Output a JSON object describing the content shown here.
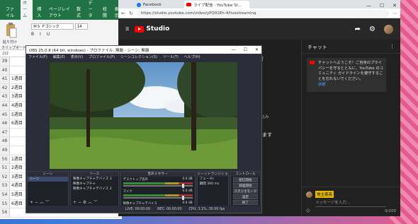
{
  "excel": {
    "tabs": [
      "ファイル",
      "ホーム",
      "挿入",
      "ページレイアウト",
      "数式",
      "データ",
      "校閲",
      "表示"
    ],
    "paste_label": "貼り付け",
    "font": "ＭＳ Ｐゴシック",
    "font_size": "14",
    "format": "B I U",
    "clipboard_label": "クリップボード",
    "cell_ref": "J12",
    "rows": [
      {
        "n": "39",
        "c": ""
      },
      {
        "n": "40",
        "c": ""
      },
      {
        "n": "41",
        "c": "1週目"
      },
      {
        "n": "42",
        "c": "2週目"
      },
      {
        "n": "43",
        "c": "3週目"
      },
      {
        "n": "44",
        "c": "4週目"
      },
      {
        "n": "45",
        "c": "5週目"
      },
      {
        "n": "46",
        "c": "6週目"
      },
      {
        "n": "47",
        "c": ""
      },
      {
        "n": "48",
        "c": ""
      },
      {
        "n": "49",
        "c": ""
      },
      {
        "n": "50",
        "c": "1週目"
      },
      {
        "n": "51",
        "c": "2週目"
      },
      {
        "n": "52",
        "c": "3週目"
      },
      {
        "n": "53",
        "c": "4週目"
      },
      {
        "n": "54",
        "c": "5週目"
      },
      {
        "n": "55",
        "c": "6週目"
      },
      {
        "n": "56",
        "c": ""
      }
    ]
  },
  "browser": {
    "tab1": "Facebook",
    "tab2": "ライブ配信 - YouTube St...",
    "url": "https://studio.youtube.com/video/yPQ91Eh-4/livestreaming",
    "studio_logo": "Studio",
    "left_text": {
      "t1": "ガ",
      "t2": "見込み",
      "t3": "0",
      "t4": "します"
    },
    "chat": {
      "title": "チャット",
      "message": "チャットへようこそ！ご自身のプライバシーを守るとともに、YouTube のコミュニティ ガイドラインを遵守することを忘れないでください。",
      "link": "詳細",
      "user": "地主恵亮",
      "placeholder": "メッセージを入力...",
      "counter": "0/200"
    }
  },
  "obs": {
    "title": "OBS 25.0.8 (64 bit, windows) - プロファイル: 無題 - シーン: 無題",
    "menu": [
      "ファイル(F)",
      "編集(E)",
      "表示(V)",
      "プロファイル(P)",
      "シーンコレクション(S)",
      "ツール(T)",
      "ヘルプ(H)"
    ],
    "scenes_header": "シーン",
    "scenes": [
      "シーン"
    ],
    "sources_header": "ソース",
    "sources": [
      "映像キャプチャデバイス 3",
      "映像キャプチャ",
      "映像キャプチャデバイス 2"
    ],
    "mixer_header": "音声ミキサー",
    "mixer": [
      {
        "name": "デスクトップ音声",
        "db": "0.0 dB"
      },
      {
        "name": "マイク",
        "db": "0.0 dB"
      },
      {
        "name": "映像キャプチャデバイス",
        "db": "0.0 dB"
      }
    ],
    "transition_header": "シーントランジション",
    "transition_name": "フェード",
    "duration_label": "期間",
    "duration": "300 ms",
    "controls_header": "コントロール",
    "controls": [
      "配信開始",
      "録画開始",
      "スタジオモード",
      "設定",
      "終了"
    ],
    "status": {
      "live": "LIVE: 00:00:00",
      "rec": "REC: 00:00:00",
      "cpu": "CPU: 3.1%, 30.00 fps"
    }
  }
}
